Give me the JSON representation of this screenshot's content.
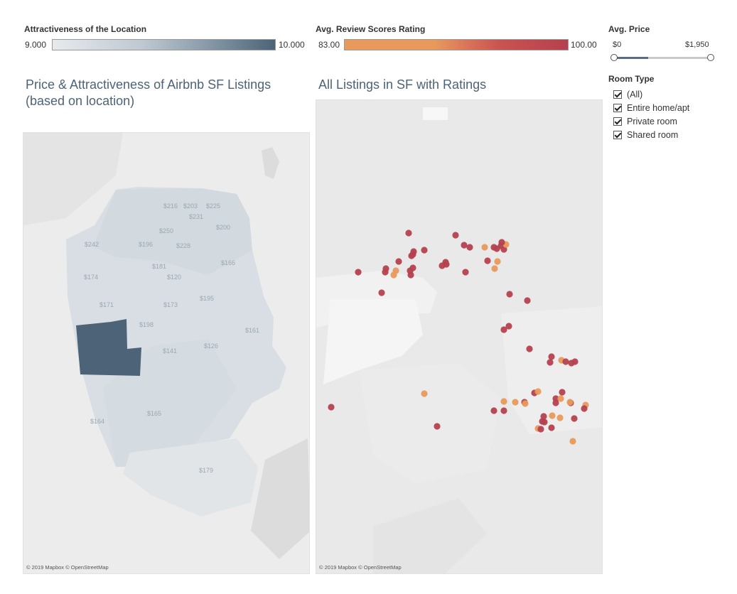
{
  "legend_attractiveness": {
    "title": "Attractiveness of the Location",
    "min": "9.000",
    "max": "10.000",
    "color_low": "#e6eaed",
    "color_high": "#4d6377"
  },
  "legend_rating": {
    "title": "Avg. Review Scores Rating",
    "min": "83.00",
    "max": "100.00",
    "color_low": "#e89a5c",
    "color_high": "#b5414f"
  },
  "price_filter": {
    "title": "Avg. Price",
    "min_label": "$0",
    "max_label": "$1,950",
    "low_value": 0,
    "high_value": 1950
  },
  "room_type": {
    "title": "Room Type",
    "options": [
      {
        "label": "(All)",
        "checked": true
      },
      {
        "label": "Entire home/apt",
        "checked": true
      },
      {
        "label": "Private room",
        "checked": true
      },
      {
        "label": "Shared room",
        "checked": true
      }
    ]
  },
  "left_map": {
    "title_line1": "Price & Attractiveness of Airbnb SF Listings",
    "title_line2": "(based on location)",
    "attribution": "© 2019 Mapbox © OpenStreetMap",
    "price_labels": [
      "$216",
      "$203",
      "$225",
      "$250",
      "$231",
      "$200",
      "$242",
      "$196",
      "$228",
      "$181",
      "$166",
      "$174",
      "$120",
      "$171",
      "$173",
      "$195",
      "$198",
      "$161",
      "$141",
      "$126",
      "$164",
      "$165",
      "$179"
    ],
    "highlighted_region_color": "#4d6377"
  },
  "right_map": {
    "title": "All Listings in SF with Ratings",
    "attribution": "© 2019 Mapbox © OpenStreetMap",
    "dot_color_dark": "#b5414f",
    "dot_color_light": "#e89a5c"
  }
}
